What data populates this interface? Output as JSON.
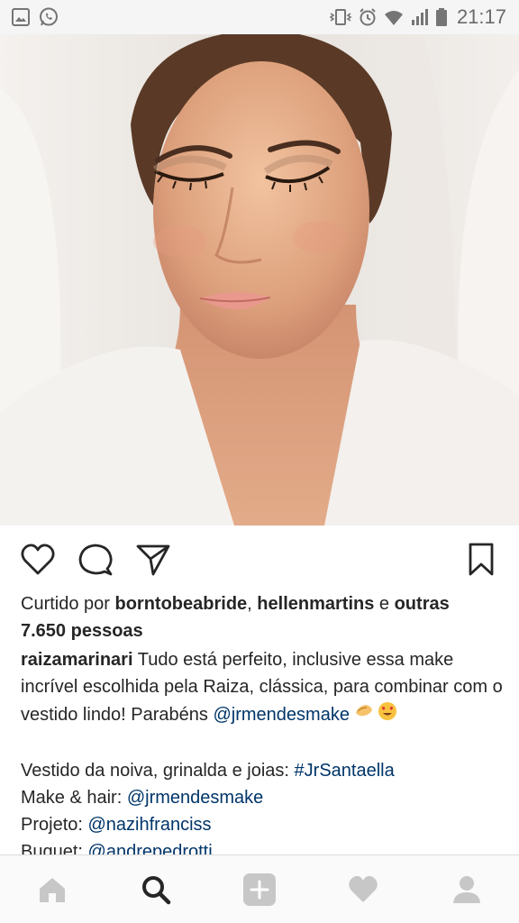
{
  "status_bar": {
    "time": "21:17",
    "left_icons": [
      "gallery-icon",
      "whatsapp-icon"
    ],
    "right_icons": [
      "vibrate-icon",
      "alarm-icon",
      "wifi-icon",
      "signal-icon",
      "battery-icon"
    ]
  },
  "post": {
    "photo_alt": "bride-portrait",
    "actions": {
      "icons": [
        "heart-icon",
        "comment-icon",
        "share-icon",
        "bookmark-icon"
      ]
    },
    "likes": {
      "prefix": "Curtido por",
      "user1": "borntobeabride",
      "sep": ",",
      "user2": "hellenmartins",
      "and": "e",
      "others": "outras",
      "count": "7.650 pessoas"
    },
    "caption": {
      "username": "raizamarinari",
      "text": "Tudo está perfeito, inclusive essa make incrível escolhida pela Raiza, clássica, para combinar com o vestido lindo! Parabéns",
      "mention": "@jrmendesmake",
      "emojis": [
        "clapping-hands-emoji",
        "heart-eyes-emoji"
      ]
    },
    "credits": [
      {
        "label": "Vestido da noiva, grinalda e joias:",
        "value": "#JrSantaella"
      },
      {
        "label": "Make & hair:",
        "value": "@jrmendesmake"
      },
      {
        "label": "Projeto:",
        "value": "@nazihfranciss"
      },
      {
        "label": "Buquet:",
        "value": "@andrepedrotti"
      }
    ]
  },
  "bottom_nav": {
    "items": [
      "home-icon",
      "search-icon",
      "add-icon",
      "activity-icon",
      "profile-icon"
    ],
    "active": "search-icon",
    "colors": {
      "inactive": "#c7c7c7",
      "active": "#262626"
    }
  },
  "colors": {
    "link": "#003569",
    "text": "#262626"
  }
}
